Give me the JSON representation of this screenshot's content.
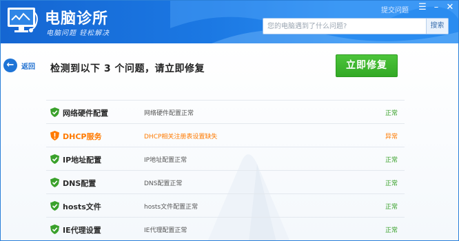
{
  "app": {
    "title": "电脑诊所",
    "subtitle": "电脑问题  轻松解决",
    "top_link": "提交问题",
    "brand_color": "#1b78e3"
  },
  "search": {
    "placeholder": "您的电脑遇到了什么问题?",
    "button_label": "搜索"
  },
  "nav": {
    "back_label": "返回"
  },
  "main": {
    "headline": "检测到以下 3 个问题，请立即修复",
    "fix_button": "立即修复"
  },
  "checks": [
    {
      "name": "网络硬件配置",
      "desc": "网络硬件配置正常",
      "status": "正常",
      "state": "ok",
      "icon": "shield-check-icon"
    },
    {
      "name": "DHCP服务",
      "desc": "DHCP相关注册表设置缺失",
      "status": "异常",
      "state": "warn",
      "icon": "shield-warning-icon"
    },
    {
      "name": "IP地址配置",
      "desc": "IP地址配置正常",
      "status": "正常",
      "state": "ok",
      "icon": "shield-check-icon"
    },
    {
      "name": "DNS配置",
      "desc": "DNS配置正常",
      "status": "正常",
      "state": "ok",
      "icon": "shield-check-icon"
    },
    {
      "name": "hosts文件",
      "desc": "hosts文件配置正常",
      "status": "正常",
      "state": "ok",
      "icon": "shield-check-icon"
    },
    {
      "name": "IE代理设置",
      "desc": "IE代理配置正常",
      "status": "正常",
      "state": "ok",
      "icon": "shield-check-icon"
    }
  ],
  "colors": {
    "ok": "#3aa12b",
    "warn": "#ff7a00",
    "fix_button": "#3db22e"
  }
}
